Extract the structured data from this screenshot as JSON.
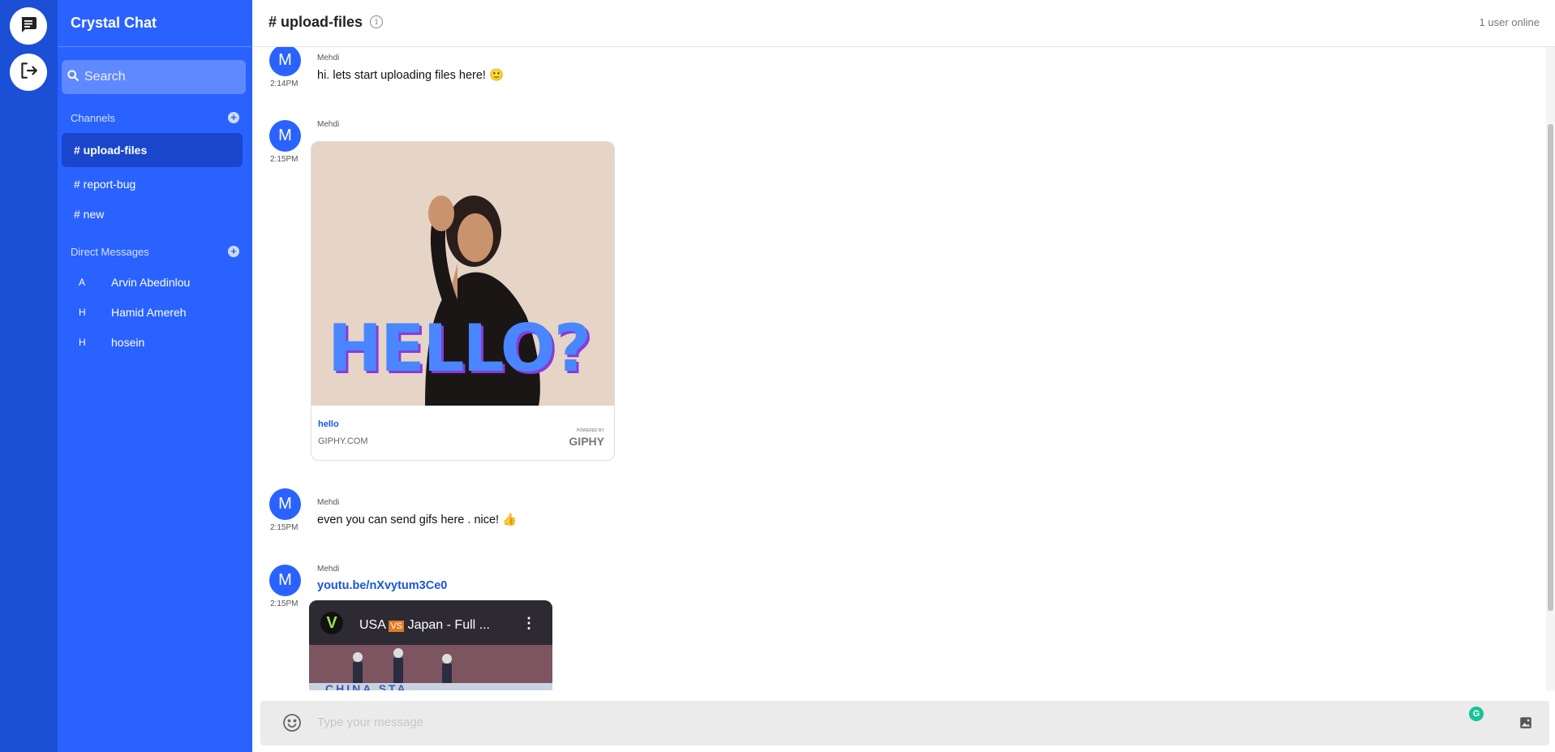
{
  "app": {
    "name": "Crystal Chat"
  },
  "rail": {
    "chat_icon": "chat-icon",
    "logout_icon": "logout-icon"
  },
  "sidebar": {
    "search_placeholder": "Search",
    "channels_title": "Channels",
    "channels": [
      {
        "label": "# upload-files",
        "active": true
      },
      {
        "label": "# report-bug",
        "active": false
      },
      {
        "label": "# new",
        "active": false
      }
    ],
    "dm_title": "Direct Messages",
    "dms": [
      {
        "initial": "A",
        "name": "Arvin Abedinlou"
      },
      {
        "initial": "H",
        "name": "Hamid Amereh"
      },
      {
        "initial": "H",
        "name": "hosein"
      }
    ]
  },
  "header": {
    "title": "# upload-files",
    "info_icon": "i",
    "online": "1 user online"
  },
  "messages": [
    {
      "initial": "M",
      "author": "Mehdi",
      "time": "2:14PM",
      "text": "hi. lets start uploading files here! 🙂"
    },
    {
      "initial": "M",
      "author": "Mehdi",
      "time": "2:15PM",
      "card": {
        "image_text": "HELLO?",
        "title": "hello",
        "site": "GIPHY.COM",
        "powered": "POWERED BY",
        "logo": "GIPHY"
      }
    },
    {
      "initial": "M",
      "author": "Mehdi",
      "time": "2:15PM",
      "text": "even you can send gifs here . nice! 👍"
    },
    {
      "initial": "M",
      "author": "Mehdi",
      "time": "2:15PM",
      "link": "youtu.be/nXvytum3Ce0",
      "video": {
        "title_a": "USA",
        "vs": "VS",
        "title_b": "Japan - Full ...",
        "banner": "CHINA STA"
      }
    }
  ],
  "composer": {
    "placeholder": "Type your message"
  },
  "colors": {
    "sidebar": "#2962ff",
    "rail": "#1b4fd6",
    "active_channel": "#1a46cc",
    "link": "#1a56d8"
  }
}
